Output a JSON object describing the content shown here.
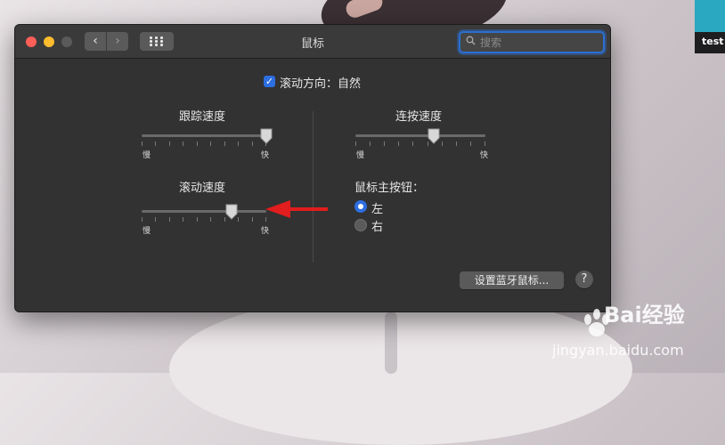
{
  "window": {
    "title": "鼠标",
    "search_placeholder": "搜索"
  },
  "natural_scroll": {
    "label": "滚动方向：自然",
    "checked": true
  },
  "tracking_speed": {
    "label": "跟踪速度",
    "min_label": "慢",
    "max_label": "快",
    "value_fraction": 1.0
  },
  "double_click_speed": {
    "label": "连按速度",
    "min_label": "慢",
    "max_label": "快",
    "value_fraction": 0.6
  },
  "scroll_speed": {
    "label": "滚动速度",
    "min_label": "慢",
    "max_label": "快",
    "value_fraction": 0.72
  },
  "primary_button": {
    "label": "鼠标主按钮：",
    "options": [
      "左",
      "右"
    ],
    "selected": "左"
  },
  "buttons": {
    "bluetooth_setup": "设置蓝牙鼠标...",
    "help": "?"
  },
  "background": {
    "corner_label": "test"
  },
  "watermark": {
    "brand": "Bai经验",
    "url": "jingyan.baidu.com"
  },
  "colors": {
    "accent": "#2d6ee0",
    "annotation_arrow": "#e11d1d",
    "window_bg": "#323232"
  }
}
